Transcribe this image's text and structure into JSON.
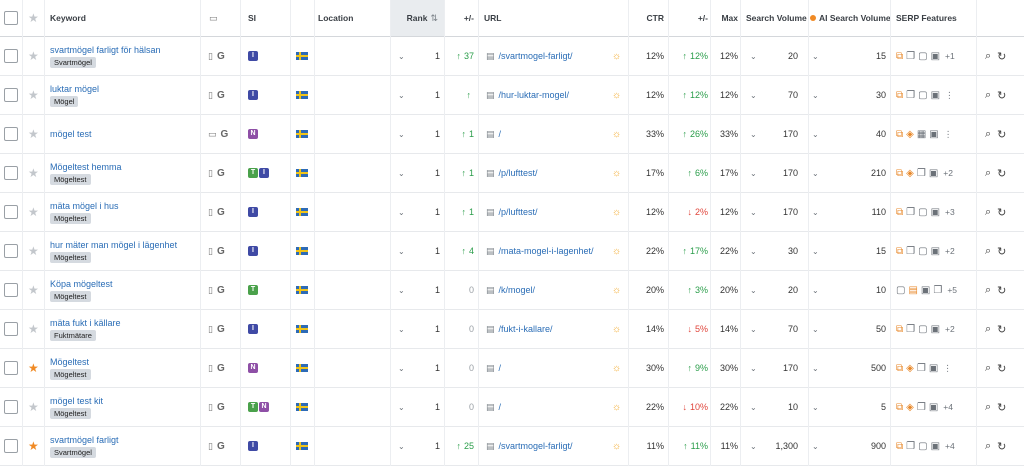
{
  "header": {
    "keyword": "Keyword",
    "si": "SI",
    "location": "Location",
    "rank": "Rank",
    "rank_sort_icon": "sort-numeric-icon",
    "change": "+/-",
    "url": "URL",
    "ctr": "CTR",
    "ctr_change": "+/-",
    "max": "Max",
    "search_volume": "Search Volume",
    "ai_search_volume": "AI Search Volume",
    "serp_features": "SERP Features"
  },
  "colors": {
    "link": "#2a6db6",
    "up": "#2a9d4a",
    "down": "#e0453b",
    "accent": "#f08a24"
  },
  "rows": [
    {
      "keyword": "svartmögel farligt för hälsan",
      "tag": "Svartmögel",
      "starred": false,
      "device": "mobile",
      "si": [
        "I"
      ],
      "rank": "1",
      "change": "37",
      "change_dir": "up",
      "url": "/svartmogel-farligt/",
      "ctr": "12%",
      "ctr_change": "12%",
      "ctr_dir": "up",
      "max": "12%",
      "volume": "20",
      "ai_volume": "15",
      "more": "+1",
      "features": [
        "puzzle",
        "copy",
        "chat",
        "image"
      ]
    },
    {
      "keyword": "luktar mögel",
      "tag": "Mögel",
      "starred": false,
      "device": "mobile",
      "si": [
        "I"
      ],
      "rank": "1",
      "change": "",
      "change_dir": "up",
      "url": "/hur-luktar-mogel/",
      "ctr": "12%",
      "ctr_change": "12%",
      "ctr_dir": "up",
      "max": "12%",
      "volume": "70",
      "ai_volume": "30",
      "more": "⋮",
      "features": [
        "puzzle",
        "copy",
        "chat",
        "image"
      ]
    },
    {
      "keyword": "mögel test",
      "tag": "",
      "starred": false,
      "device": "desktop",
      "si": [
        "N"
      ],
      "rank": "1",
      "change": "1",
      "change_dir": "up",
      "url": "/",
      "ctr": "33%",
      "ctr_change": "26%",
      "ctr_dir": "up",
      "max": "33%",
      "volume": "170",
      "ai_volume": "40",
      "more": "⋮",
      "features": [
        "puzzle",
        "tag",
        "grid",
        "image"
      ]
    },
    {
      "keyword": "Mögeltest hemma",
      "tag": "Mögeltest",
      "starred": false,
      "device": "mobile",
      "si": [
        "T",
        "I"
      ],
      "rank": "1",
      "change": "1",
      "change_dir": "up",
      "url": "/p/lufttest/",
      "ctr": "17%",
      "ctr_change": "6%",
      "ctr_dir": "up",
      "max": "17%",
      "volume": "170",
      "ai_volume": "210",
      "more": "+2",
      "features": [
        "puzzle",
        "tag",
        "copy",
        "image"
      ]
    },
    {
      "keyword": "mäta mögel i hus",
      "tag": "Mögeltest",
      "starred": false,
      "device": "mobile",
      "si": [
        "I"
      ],
      "rank": "1",
      "change": "1",
      "change_dir": "up",
      "url": "/p/lufttest/",
      "ctr": "12%",
      "ctr_change": "2%",
      "ctr_dir": "down",
      "max": "12%",
      "volume": "170",
      "ai_volume": "110",
      "more": "+3",
      "features": [
        "puzzle",
        "copy",
        "chat",
        "image"
      ]
    },
    {
      "keyword": "hur mäter man mögel i lägenhet",
      "tag": "Mögeltest",
      "starred": false,
      "device": "mobile",
      "si": [
        "I"
      ],
      "rank": "1",
      "change": "4",
      "change_dir": "up",
      "url": "/mata-mogel-i-lagenhet/",
      "ctr": "22%",
      "ctr_change": "17%",
      "ctr_dir": "up",
      "max": "22%",
      "volume": "30",
      "ai_volume": "15",
      "more": "+2",
      "features": [
        "puzzle",
        "copy",
        "chat",
        "image"
      ]
    },
    {
      "keyword": "Köpa mögeltest",
      "tag": "Mögeltest",
      "starred": false,
      "device": "mobile",
      "si": [
        "T"
      ],
      "rank": "1",
      "change": "0",
      "change_dir": "zero",
      "url": "/k/mogel/",
      "ctr": "20%",
      "ctr_change": "3%",
      "ctr_dir": "up",
      "max": "20%",
      "volume": "20",
      "ai_volume": "10",
      "more": "+5",
      "features": [
        "chat",
        "cart",
        "image",
        "copy"
      ]
    },
    {
      "keyword": "mäta fukt i källare",
      "tag": "Fuktmätare",
      "starred": false,
      "device": "mobile",
      "si": [
        "I"
      ],
      "rank": "1",
      "change": "0",
      "change_dir": "zero",
      "url": "/fukt-i-kallare/",
      "ctr": "14%",
      "ctr_change": "5%",
      "ctr_dir": "down",
      "max": "14%",
      "volume": "70",
      "ai_volume": "50",
      "more": "+2",
      "features": [
        "puzzle",
        "copy",
        "chat",
        "image"
      ]
    },
    {
      "keyword": "Mögeltest",
      "tag": "Mögeltest",
      "starred": true,
      "device": "mobile",
      "si": [
        "N"
      ],
      "rank": "1",
      "change": "0",
      "change_dir": "zero",
      "url": "/",
      "ctr": "30%",
      "ctr_change": "9%",
      "ctr_dir": "up",
      "max": "30%",
      "volume": "170",
      "ai_volume": "500",
      "more": "⋮",
      "features": [
        "puzzle",
        "tag",
        "copy",
        "image"
      ]
    },
    {
      "keyword": "mögel test kit",
      "tag": "Mögeltest",
      "starred": false,
      "device": "mobile",
      "si": [
        "T",
        "N"
      ],
      "rank": "1",
      "change": "0",
      "change_dir": "zero",
      "url": "/",
      "ctr": "22%",
      "ctr_change": "10%",
      "ctr_dir": "down",
      "max": "22%",
      "volume": "10",
      "ai_volume": "5",
      "more": "+4",
      "features": [
        "puzzle",
        "tag",
        "copy",
        "image"
      ]
    },
    {
      "keyword": "svartmögel farligt",
      "tag": "Svartmögel",
      "starred": true,
      "device": "mobile",
      "si": [
        "I"
      ],
      "rank": "1",
      "change": "25",
      "change_dir": "up",
      "url": "/svartmogel-farligt/",
      "ctr": "11%",
      "ctr_change": "11%",
      "ctr_dir": "up",
      "max": "11%",
      "volume": "1,300",
      "ai_volume": "900",
      "more": "+4",
      "features": [
        "puzzle",
        "copy",
        "chat",
        "image"
      ]
    }
  ]
}
